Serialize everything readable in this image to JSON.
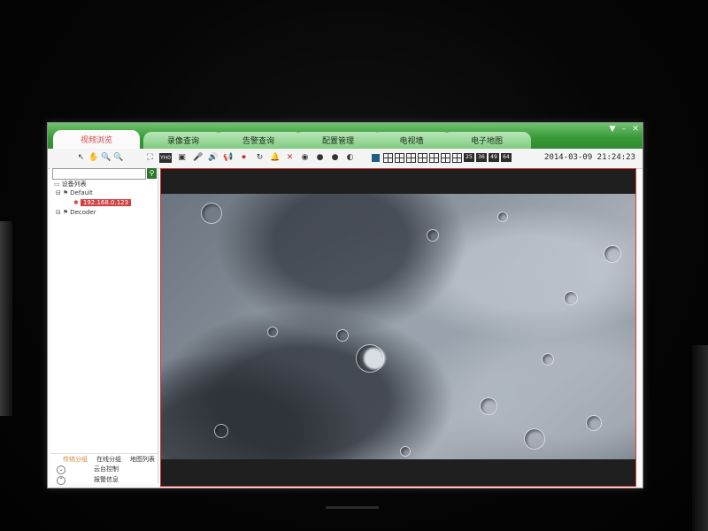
{
  "app": {
    "tabs": [
      {
        "label": "视频浏览",
        "active": true
      },
      {
        "label": "录像查询",
        "active": false
      },
      {
        "label": "告警查询",
        "active": false
      },
      {
        "label": "配置管理",
        "active": false
      },
      {
        "label": "电视墙",
        "active": false
      },
      {
        "label": "电子地图",
        "active": false
      }
    ],
    "window_buttons": {
      "menu": "▼",
      "minimize": "–",
      "close": "✕"
    },
    "accent_color": "#3a9a3a",
    "highlight_color": "#d44040"
  },
  "toolbar": {
    "icons": [
      {
        "name": "pointer-icon",
        "glyph": "↖"
      },
      {
        "name": "hand-icon",
        "glyph": "✋"
      },
      {
        "name": "zoom-in-icon",
        "glyph": "🔍"
      },
      {
        "name": "zoom-out-icon",
        "glyph": "🔍"
      },
      {
        "name": "fullscreen-icon",
        "glyph": "⛶"
      },
      {
        "name": "ptz-icon",
        "glyph": "YH0"
      },
      {
        "name": "snapshot-icon",
        "glyph": "▣"
      },
      {
        "name": "microphone-icon",
        "glyph": "🎤"
      },
      {
        "name": "volume-icon",
        "glyph": "🔊"
      },
      {
        "name": "talk-icon",
        "glyph": "📢"
      },
      {
        "name": "record-icon",
        "glyph": "⏺"
      },
      {
        "name": "refresh-icon",
        "glyph": "↻"
      },
      {
        "name": "alarm-icon",
        "glyph": "🔔"
      },
      {
        "name": "close-all-icon",
        "glyph": "✕"
      },
      {
        "name": "camera-icon",
        "glyph": "◉"
      },
      {
        "name": "play-icon",
        "glyph": "●"
      },
      {
        "name": "stop-icon",
        "glyph": "●"
      },
      {
        "name": "settings-icon",
        "glyph": "◐"
      }
    ],
    "layouts": [
      "1",
      "4",
      "6",
      "8",
      "9",
      "10",
      "13",
      "16",
      "25",
      "36",
      "49",
      "64"
    ],
    "datetime": "2014-03-09 21:24:23"
  },
  "device_tree": {
    "root_label": "设备列表",
    "nodes": [
      {
        "label": "Default",
        "level": 1
      },
      {
        "label": "192.168.0.123",
        "level": 2,
        "selected": true
      },
      {
        "label": "Decoder",
        "level": 1
      }
    ]
  },
  "panel_tabs": [
    {
      "label": "传统分组",
      "active": true
    },
    {
      "label": "在线分组",
      "active": false
    },
    {
      "label": "地图列表",
      "active": false
    }
  ],
  "controls": [
    {
      "icon": "chevron-down-icon",
      "label": "云台控制"
    },
    {
      "icon": "chevron-up-icon",
      "label": "报警信息"
    }
  ]
}
